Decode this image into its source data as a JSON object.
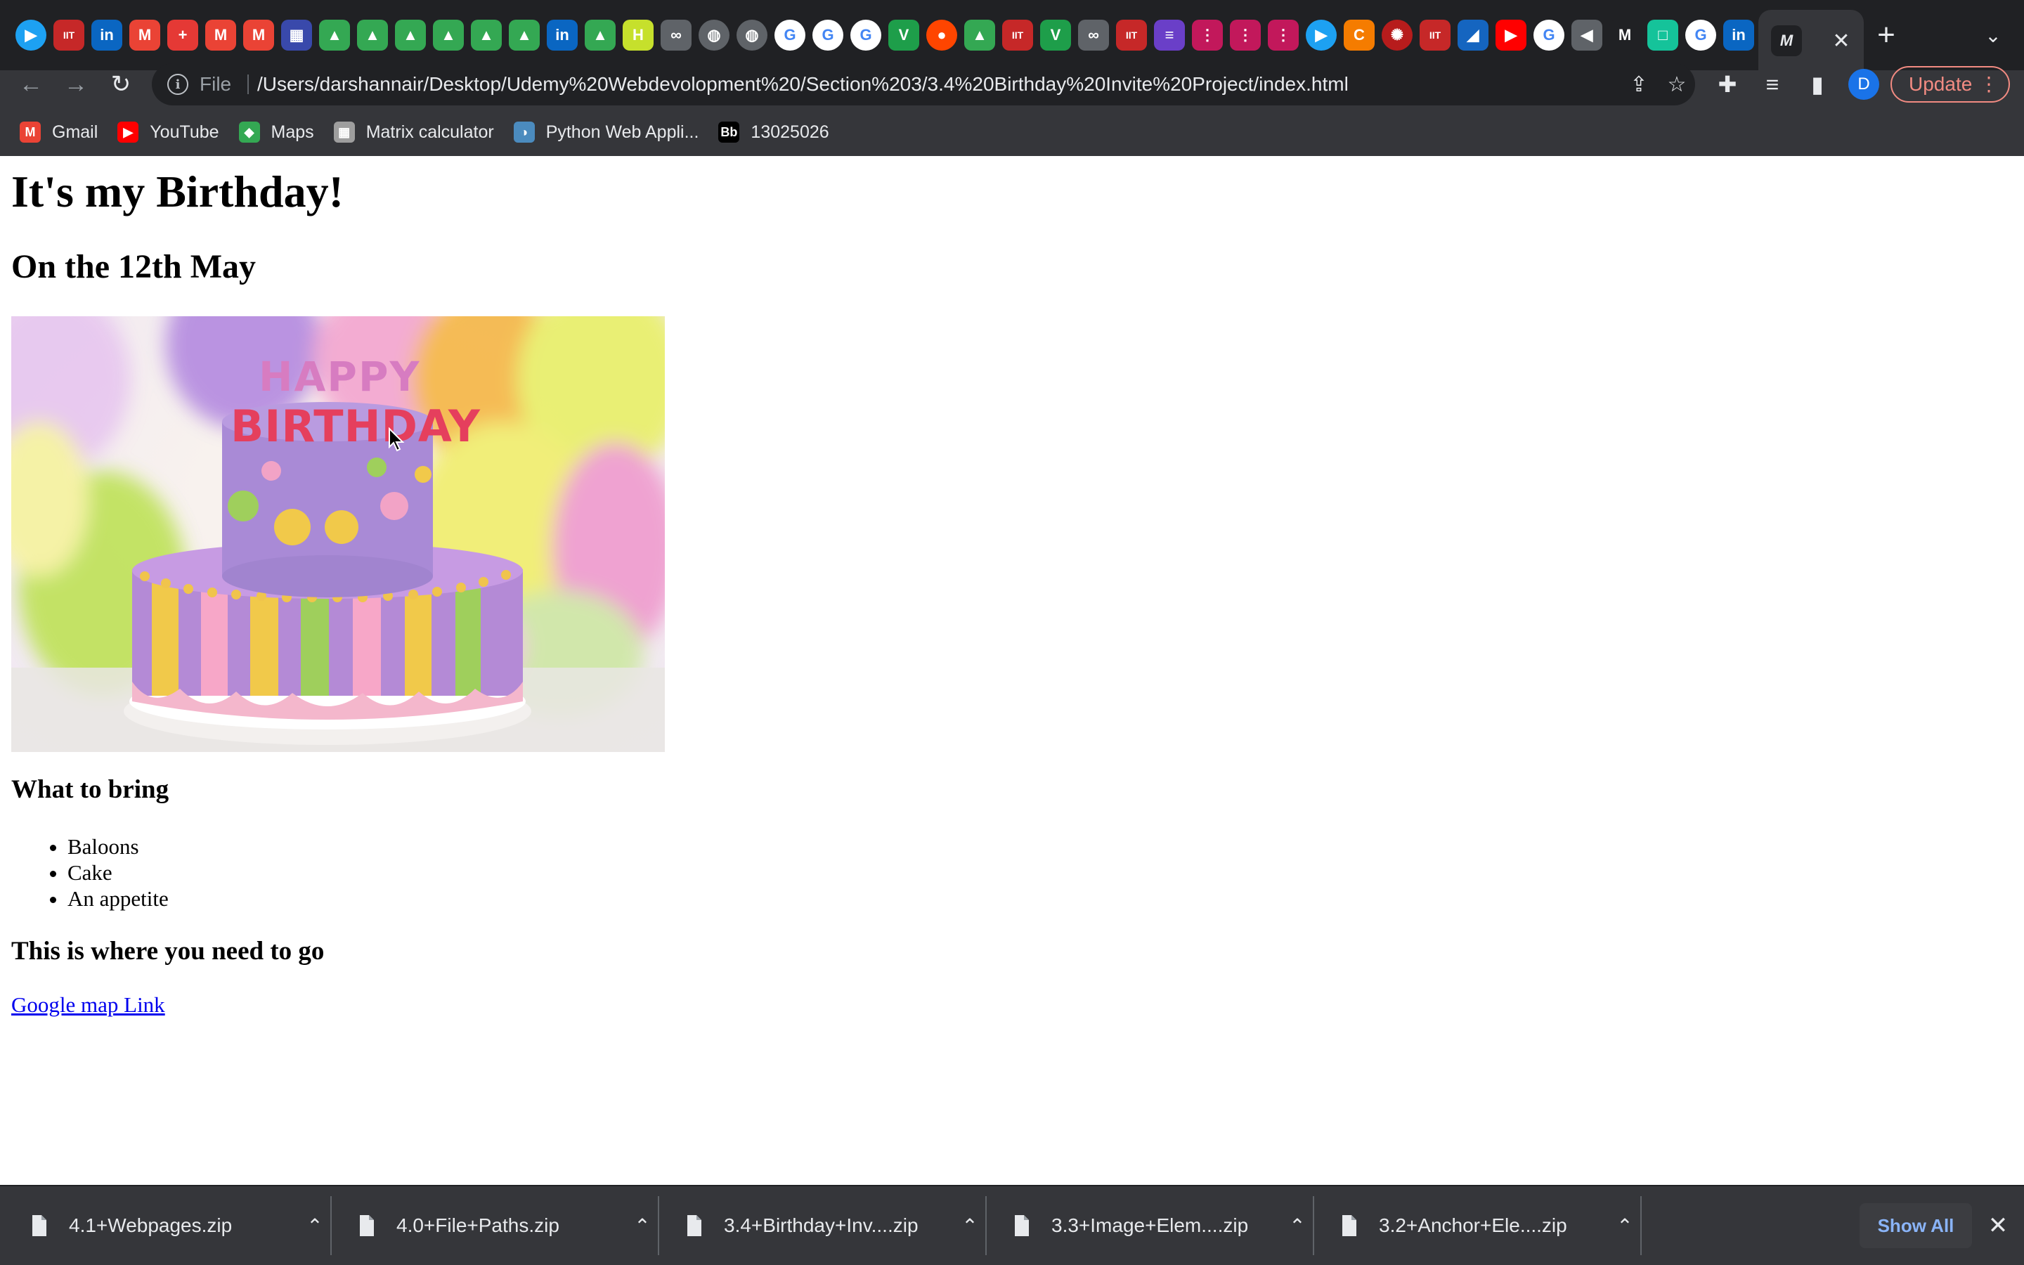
{
  "browser": {
    "tab_favicons": [
      {
        "icon": "play-icon",
        "glyph": "▶",
        "color": "#1da1f2",
        "round": true
      },
      {
        "icon": "iit-icon",
        "glyph": "IIT",
        "color": "#c62828"
      },
      {
        "icon": "linkedin-icon",
        "glyph": "in",
        "color": "#0a66c2"
      },
      {
        "icon": "gmail-icon",
        "glyph": "M",
        "color": "#ea4335"
      },
      {
        "icon": "swiss-cross-icon",
        "glyph": "+",
        "color": "#e53935"
      },
      {
        "icon": "gmail-icon",
        "glyph": "M",
        "color": "#ea4335"
      },
      {
        "icon": "gmail-icon",
        "glyph": "M",
        "color": "#ea4335"
      },
      {
        "icon": "calendar-icon",
        "glyph": "▦",
        "color": "#3949ab"
      },
      {
        "icon": "drive-icon",
        "glyph": "▲",
        "color": "#34a853"
      },
      {
        "icon": "drive-icon",
        "glyph": "▲",
        "color": "#34a853"
      },
      {
        "icon": "drive-icon",
        "glyph": "▲",
        "color": "#34a853"
      },
      {
        "icon": "drive-icon",
        "glyph": "▲",
        "color": "#34a853"
      },
      {
        "icon": "drive-icon",
        "glyph": "▲",
        "color": "#34a853"
      },
      {
        "icon": "drive-icon",
        "glyph": "▲",
        "color": "#34a853"
      },
      {
        "icon": "linkedin-icon",
        "glyph": "in",
        "color": "#0a66c2"
      },
      {
        "icon": "drive-icon",
        "glyph": "▲",
        "color": "#34a853"
      },
      {
        "icon": "h-icon",
        "glyph": "H",
        "color": "#c6e02c"
      },
      {
        "icon": "link-icon",
        "glyph": "∞",
        "color": "#5f6368"
      },
      {
        "icon": "globe-icon",
        "glyph": "◍",
        "color": "#5f6368",
        "round": true
      },
      {
        "icon": "globe-icon",
        "glyph": "◍",
        "color": "#5f6368",
        "round": true
      },
      {
        "icon": "google-icon",
        "glyph": "G",
        "color": "#ffffff",
        "round": true
      },
      {
        "icon": "google-icon",
        "glyph": "G",
        "color": "#ffffff",
        "round": true
      },
      {
        "icon": "google-icon",
        "glyph": "G",
        "color": "#ffffff",
        "round": true
      },
      {
        "icon": "tv-icon",
        "glyph": "V",
        "color": "#1e9e4a"
      },
      {
        "icon": "reddit-icon",
        "glyph": "●",
        "color": "#ff4500",
        "round": true
      },
      {
        "icon": "drive-icon",
        "glyph": "▲",
        "color": "#34a853"
      },
      {
        "icon": "iit-icon",
        "glyph": "IIT",
        "color": "#c62828"
      },
      {
        "icon": "tv-icon",
        "glyph": "V",
        "color": "#1e9e4a"
      },
      {
        "icon": "link-icon",
        "glyph": "∞",
        "color": "#5f6368"
      },
      {
        "icon": "iit-icon",
        "glyph": "IIT",
        "color": "#c62828"
      },
      {
        "icon": "list-icon",
        "glyph": "≡",
        "color": "#6a3fc8"
      },
      {
        "icon": "dotted-list-icon",
        "glyph": "⋮",
        "color": "#c2185b"
      },
      {
        "icon": "dotted-list-icon",
        "glyph": "⋮",
        "color": "#c2185b"
      },
      {
        "icon": "dotted-list-icon",
        "glyph": "⋮",
        "color": "#c2185b"
      },
      {
        "icon": "play-icon",
        "glyph": "▶",
        "color": "#1da1f2",
        "round": true
      },
      {
        "icon": "c-icon",
        "glyph": "C",
        "color": "#f57c00"
      },
      {
        "icon": "gear-red-icon",
        "glyph": "✺",
        "color": "#b71c1c",
        "round": true
      },
      {
        "icon": "iit-icon",
        "glyph": "IIT",
        "color": "#c62828"
      },
      {
        "icon": "flag-icon",
        "glyph": "◢",
        "color": "#1565c0"
      },
      {
        "icon": "youtube-icon",
        "glyph": "▶",
        "color": "#ff0000"
      },
      {
        "icon": "google-icon",
        "glyph": "G",
        "color": "#ffffff",
        "round": true
      },
      {
        "icon": "speaker-icon",
        "glyph": "◀",
        "color": "#5f6368"
      },
      {
        "icon": "medium-icon",
        "glyph": "M",
        "color": "#202124"
      },
      {
        "icon": "grammarly-icon",
        "glyph": "□",
        "color": "#15c39a"
      },
      {
        "icon": "google-icon",
        "glyph": "G",
        "color": "#ffffff",
        "round": true
      },
      {
        "icon": "linkedin-icon",
        "glyph": "in",
        "color": "#0a66c2"
      }
    ],
    "active_tab": {
      "icon": "medium-icon",
      "glyph": "M",
      "close": "✕"
    },
    "new_tab": "+",
    "tab_search": "⌄",
    "back": "←",
    "forward": "→",
    "reload": "↻",
    "omnibox": {
      "info": "i",
      "scheme_label": "File",
      "url": "/Users/darshannair/Desktop/Udemy%20Webdevolopment%20/Section%203/3.4%20Birthday%20Invite%20Project/index.html",
      "share": "⇪",
      "bookmark_star": "☆"
    },
    "extensions": "✚",
    "media": "≡",
    "side_panel": "▮",
    "profile_initial": "D",
    "update_label": "Update",
    "menu": "⋮",
    "bookmarks": [
      {
        "icon": "gmail-icon",
        "glyph": "M",
        "color": "#ea4335",
        "label": "Gmail"
      },
      {
        "icon": "youtube-icon",
        "glyph": "▶",
        "color": "#ff0000",
        "label": "YouTube"
      },
      {
        "icon": "maps-icon",
        "glyph": "◆",
        "color": "#34a853",
        "label": "Maps"
      },
      {
        "icon": "calculator-icon",
        "glyph": "▦",
        "color": "#9e9e9e",
        "label": "Matrix calculator"
      },
      {
        "icon": "python-icon",
        "glyph": "◑",
        "color": "#4b8bbe",
        "label": "Python Web Appli..."
      },
      {
        "icon": "blackboard-icon",
        "glyph": "Bb",
        "color": "#000000",
        "label": "13025026"
      }
    ]
  },
  "page": {
    "heading": "It's my Birthday!",
    "date_heading": "On the 12th May",
    "cake_image": {
      "top_word": "HAPPY",
      "bottom_word": "BIRTHDAY"
    },
    "bring_heading": "What to bring",
    "bring_items": [
      "Baloons",
      "Cake",
      "An appetite"
    ],
    "location_heading": "This is where you need to go",
    "map_link": "Google map Link"
  },
  "downloads": {
    "items": [
      {
        "name": "4.1+Webpages.zip",
        "caret": "⌃"
      },
      {
        "name": "4.0+File+Paths.zip",
        "caret": "⌃"
      },
      {
        "name": "3.4+Birthday+Inv....zip",
        "caret": "⌃"
      },
      {
        "name": "3.3+Image+Elem....zip",
        "caret": "⌃"
      },
      {
        "name": "3.2+Anchor+Ele....zip",
        "caret": "⌃"
      }
    ],
    "show_all": "Show All",
    "close": "✕"
  }
}
